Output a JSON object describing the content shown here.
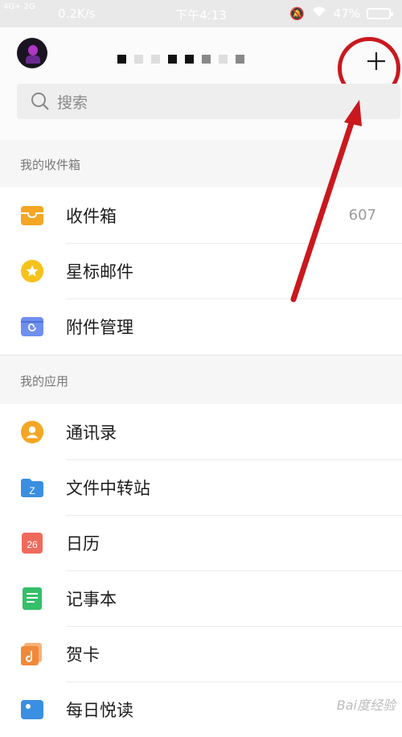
{
  "status_bar": {
    "network": "4G+ 2G",
    "speed": "0.2K/s",
    "time": "下午4:13",
    "battery": "47%"
  },
  "header": {
    "search_placeholder": "搜索"
  },
  "sections": [
    {
      "title": "我的收件箱",
      "items": [
        {
          "label": "收件箱",
          "count": "607",
          "icon": "inbox-icon"
        },
        {
          "label": "星标邮件",
          "icon": "star-icon"
        },
        {
          "label": "附件管理",
          "icon": "attachment-icon"
        }
      ]
    },
    {
      "title": "我的应用",
      "items": [
        {
          "label": "通讯录",
          "icon": "contacts-icon"
        },
        {
          "label": "文件中转站",
          "icon": "file-transfer-icon",
          "icon_text": "Z"
        },
        {
          "label": "日历",
          "icon": "calendar-icon",
          "icon_text": "26"
        },
        {
          "label": "记事本",
          "icon": "notepad-icon"
        },
        {
          "label": "贺卡",
          "icon": "greeting-card-icon"
        },
        {
          "label": "每日悦读",
          "icon": "daily-reading-icon"
        }
      ]
    }
  ],
  "colors": {
    "annotation_red": "#c9181e",
    "inbox": "#f5a623",
    "star": "#f6c21c",
    "attachment": "#6f8ff0",
    "contacts": "#f5a623",
    "file_transfer": "#3b8fe0",
    "calendar": "#f06a5c",
    "notepad": "#34c06a",
    "greeting_card": "#f08a3a",
    "daily_reading": "#3b8fe0"
  },
  "watermark": "Bai度经验"
}
